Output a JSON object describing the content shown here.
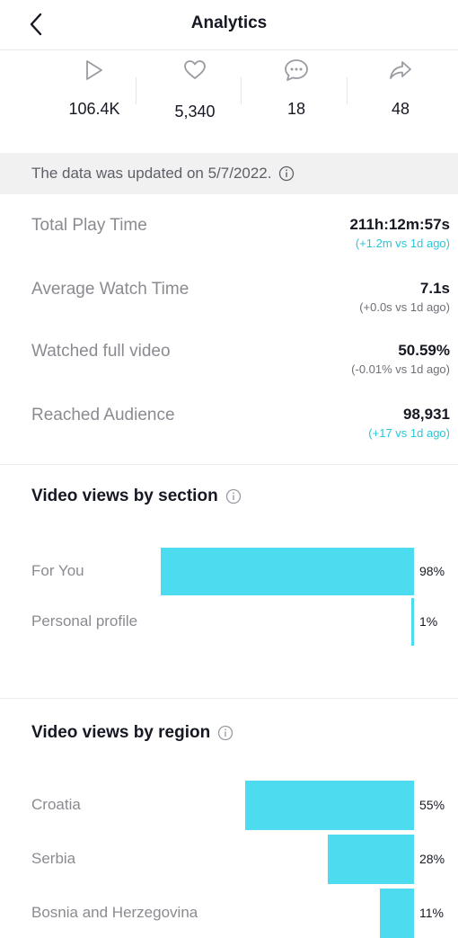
{
  "header": {
    "title": "Analytics"
  },
  "stats": [
    {
      "icon": "play-icon",
      "value": "106.4K"
    },
    {
      "icon": "heart-icon",
      "value": "5,340"
    },
    {
      "icon": "comment-icon",
      "value": "18"
    },
    {
      "icon": "share-icon",
      "value": "48"
    }
  ],
  "banner": {
    "text": "The data was updated on 5/7/2022."
  },
  "metrics": [
    {
      "label": "Total Play Time",
      "value": "211h:12m:57s",
      "delta": "(+1.2m vs 1d ago)",
      "delta_color": "cyan"
    },
    {
      "label": "Average Watch Time",
      "value": "7.1s",
      "delta": "(+0.0s vs 1d ago)",
      "delta_color": "gray"
    },
    {
      "label": "Watched full video",
      "value": "50.59%",
      "delta": "(-0.01% vs 1d ago)",
      "delta_color": "gray"
    },
    {
      "label": "Reached Audience",
      "value": "98,931",
      "delta": "(+17 vs 1d ago)",
      "delta_color": "cyan"
    }
  ],
  "sections": {
    "by_section": {
      "title": "Video views by section",
      "rows": [
        {
          "label": "For You",
          "percent": 98,
          "percent_label": "98%"
        },
        {
          "label": "Personal profile",
          "percent": 1,
          "percent_label": "1%"
        }
      ]
    },
    "by_region": {
      "title": "Video views by region",
      "rows": [
        {
          "label": "Croatia",
          "percent": 55,
          "percent_label": "55%"
        },
        {
          "label": "Serbia",
          "percent": 28,
          "percent_label": "28%"
        },
        {
          "label": "Bosnia and Herzegovina",
          "percent": 11,
          "percent_label": "11%"
        }
      ]
    }
  },
  "colors": {
    "accent": "#4ddbf0",
    "delta_positive": "#2bc6d8",
    "banner_bg": "#f1f1f2"
  }
}
